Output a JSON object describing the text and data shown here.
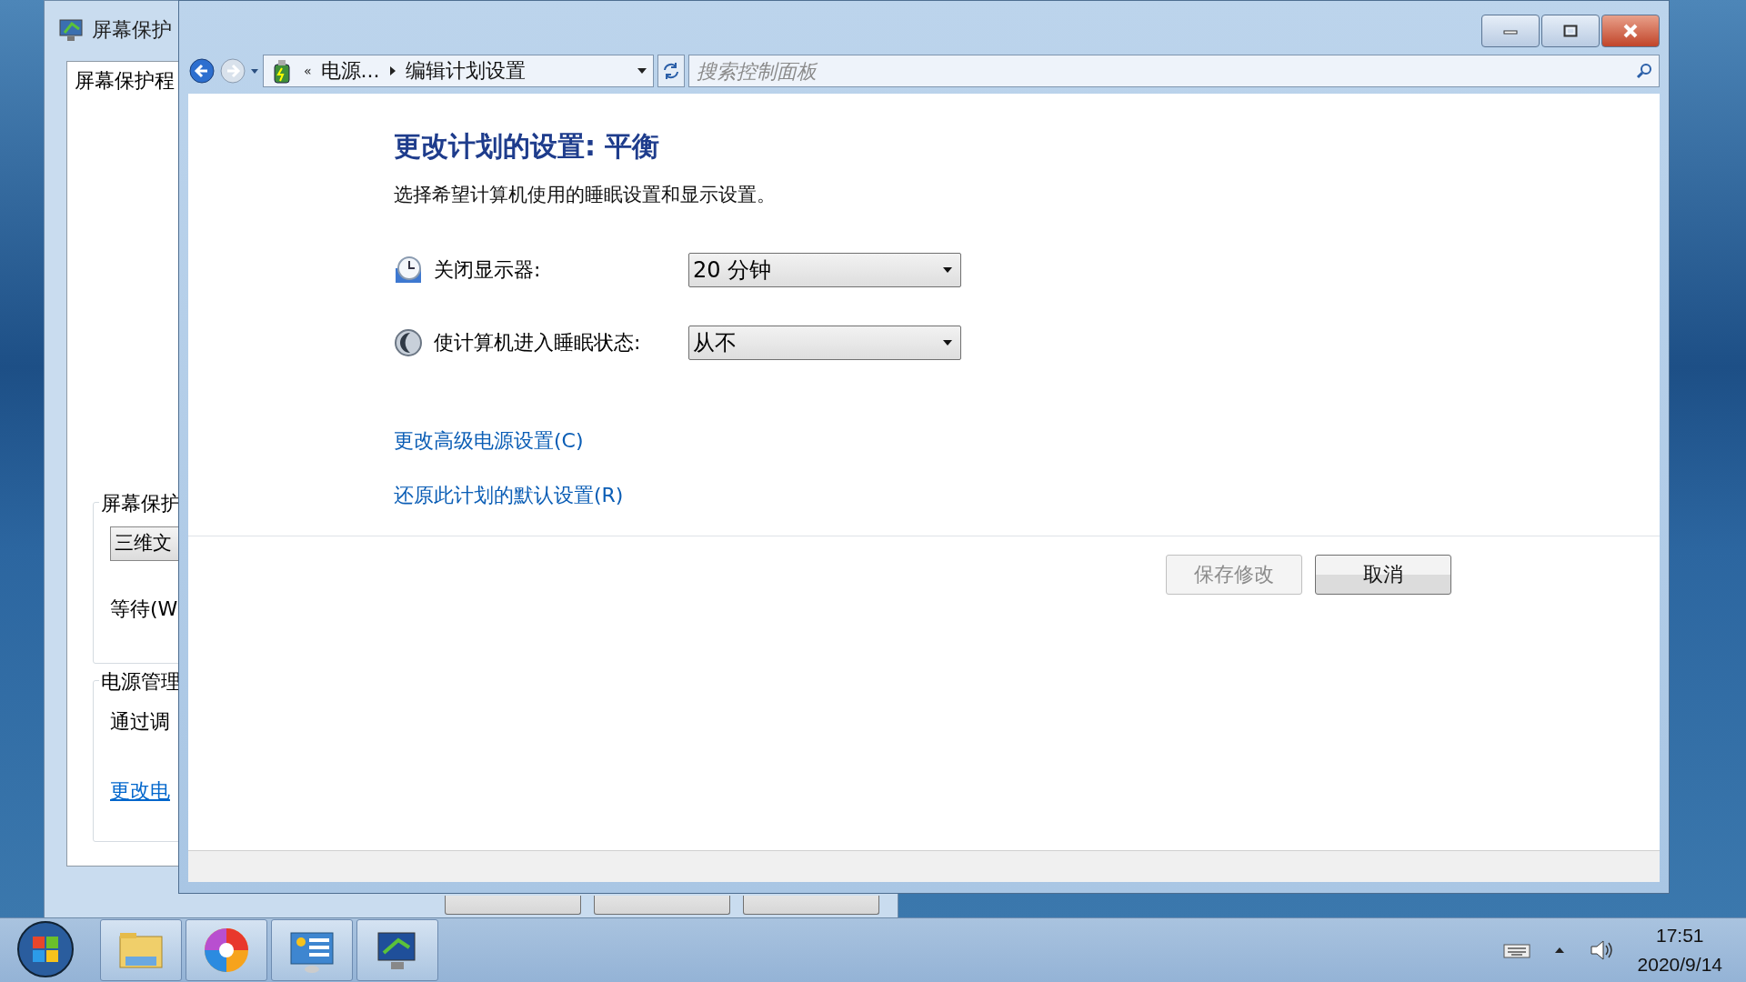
{
  "background_window": {
    "title": "屏幕保护",
    "tab": "屏幕保护程",
    "screensaver_group": "屏幕保护",
    "screensaver_select": "三维文",
    "wait_label": "等待(W",
    "power_group": "电源管理",
    "power_text": "通过调",
    "power_link": "更改电"
  },
  "window": {
    "overflow_chevron": "«",
    "breadcrumbs": [
      "电源...",
      "编辑计划设置"
    ],
    "search": {
      "placeholder": "搜索控制面板"
    },
    "heading": "更改计划的设置: 平衡",
    "subtitle": "选择希望计算机使用的睡眠设置和显示设置。",
    "settings": [
      {
        "kind": "display",
        "label": "关闭显示器:",
        "value": "20 分钟"
      },
      {
        "kind": "sleep",
        "label": "使计算机进入睡眠状态:",
        "value": "从不"
      }
    ],
    "links": [
      "更改高级电源设置(C)",
      "还原此计划的默认设置(R)"
    ],
    "buttons": [
      {
        "label": "保存修改",
        "disabled": true
      },
      {
        "label": "取消",
        "disabled": false
      }
    ]
  },
  "taskbar": {
    "items": [
      {
        "kind": "folder"
      },
      {
        "kind": "pinwheel"
      },
      {
        "kind": "control-panel"
      },
      {
        "kind": "display-settings"
      }
    ]
  },
  "clock": {
    "time": "17:51",
    "date": "2020/9/14"
  }
}
